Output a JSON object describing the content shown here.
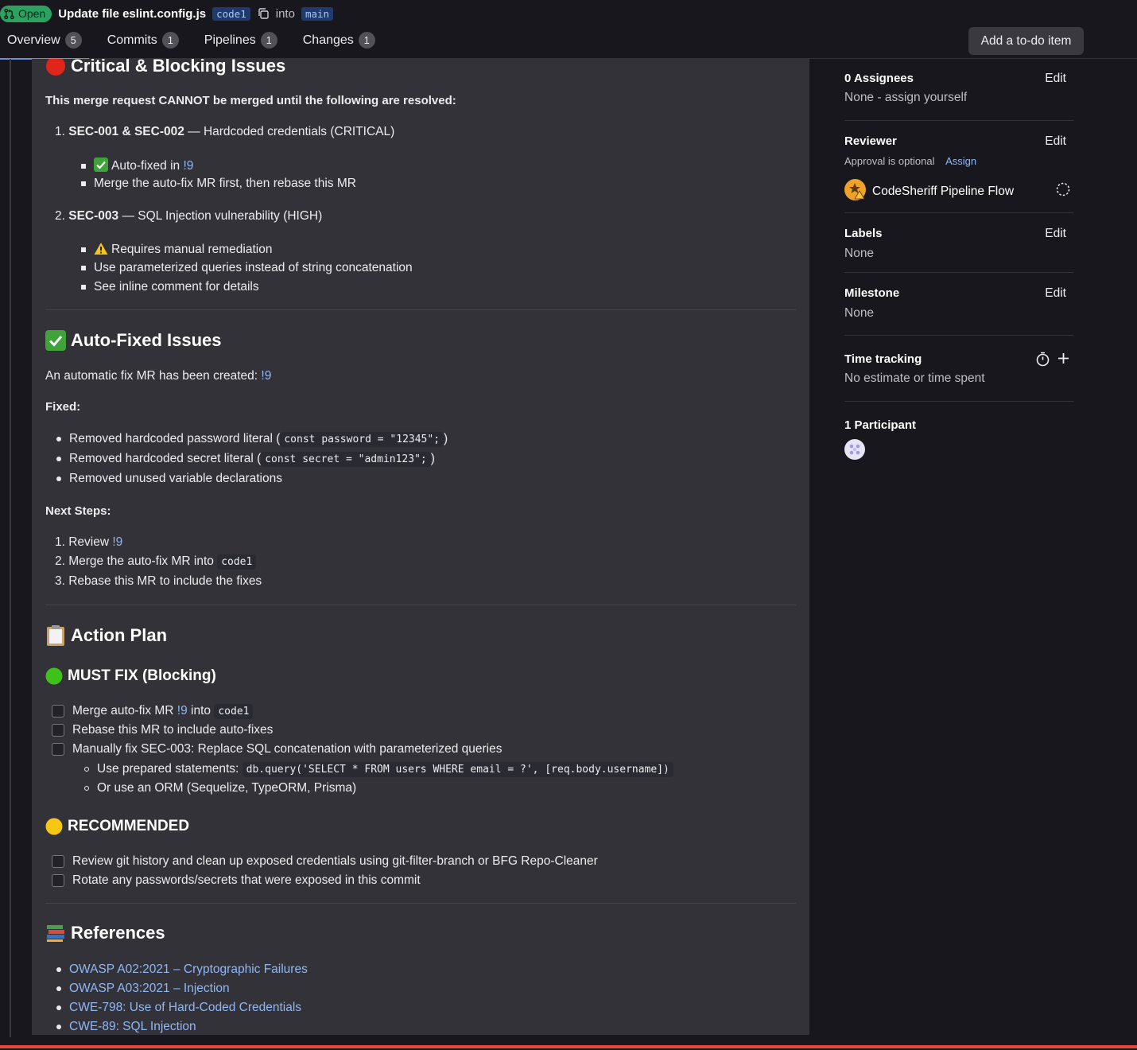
{
  "header": {
    "status": "Open",
    "title": "Update file eslint.config.js",
    "source_branch": "code1",
    "into": "into",
    "target_branch": "main",
    "tabs": [
      {
        "label": "Overview",
        "count": "5"
      },
      {
        "label": "Commits",
        "count": "1"
      },
      {
        "label": "Pipelines",
        "count": "1"
      },
      {
        "label": "Changes",
        "count": "1"
      }
    ],
    "todo_button": "Add a to-do item"
  },
  "note": {
    "critical": {
      "heading": "Critical & Blocking Issues",
      "intro": "This merge request CANNOT be merged until the following are resolved:",
      "item1": {
        "num": "1.",
        "bold": "SEC-001 & SEC-002",
        "rest": " — Hardcoded credentials (CRITICAL)",
        "sub1_pre": "Auto-fixed in ",
        "sub1_link": "!9",
        "sub2": "Merge the auto-fix MR first, then rebase this MR"
      },
      "item2": {
        "num": "2.",
        "bold": "SEC-003",
        "rest": " — SQL Injection vulnerability (HIGH)",
        "sub1": "Requires manual remediation",
        "sub2": "Use parameterized queries instead of string concatenation",
        "sub3": "See inline comment for details"
      }
    },
    "autofixed": {
      "heading": "Auto-Fixed Issues",
      "intro_pre": "An automatic fix MR has been created: ",
      "intro_link": "!9",
      "fixed_label": "Fixed:",
      "fixed1_pre": "Removed hardcoded password literal (",
      "fixed1_code": "const password = \"12345\";",
      "fixed1_post": ")",
      "fixed2_pre": "Removed hardcoded secret literal (",
      "fixed2_code": "const secret = \"admin123\";",
      "fixed2_post": ")",
      "fixed3": "Removed unused variable declarations",
      "next_label": "Next Steps:",
      "step1_pre": "Review ",
      "step1_link": "!9",
      "step2_pre": "Merge the auto-fix MR into ",
      "step2_code": "code1",
      "step3": "Rebase this MR to include the fixes"
    },
    "plan": {
      "heading": "Action Plan",
      "must_heading": "MUST FIX (Blocking)",
      "must1_pre": "Merge auto-fix MR ",
      "must1_link": "!9",
      "must1_mid": " into ",
      "must1_code": "code1",
      "must2": "Rebase this MR to include auto-fixes",
      "must3": "Manually fix SEC-003: Replace SQL concatenation with parameterized queries",
      "must3_sub1_pre": "Use prepared statements: ",
      "must3_sub1_code": "db.query('SELECT * FROM users WHERE email = ?', [req.body.username])",
      "must3_sub2": "Or use an ORM (Sequelize, TypeORM, Prisma)",
      "rec_heading": "RECOMMENDED",
      "rec1": "Review git history and clean up exposed credentials using git-filter-branch or BFG Repo-Cleaner",
      "rec2": "Rotate any passwords/secrets that were exposed in this commit"
    },
    "references": {
      "heading": "References",
      "links": [
        "OWASP A02:2021 – Cryptographic Failures",
        "OWASP A03:2021 – Injection",
        "CWE-798: Use of Hard-Coded Credentials",
        "CWE-89: SQL Injection"
      ]
    }
  },
  "sidebar": {
    "assignees_label": "0 Assignees",
    "assignees_value": "None - assign yourself",
    "reviewer_label": "Reviewer",
    "approval_text": "Approval is optional",
    "assign_link": "Assign",
    "reviewer_name": "CodeSheriff Pipeline Flow",
    "labels_label": "Labels",
    "labels_value": "None",
    "milestone_label": "Milestone",
    "milestone_value": "None",
    "time_label": "Time tracking",
    "time_value": "No estimate or time spent",
    "participants_label": "1 Participant",
    "edit": "Edit"
  },
  "colors": {
    "accent_link": "#8fb7f5",
    "status_open": "#2da160",
    "background": "#18171d",
    "note_background": "#333238"
  }
}
